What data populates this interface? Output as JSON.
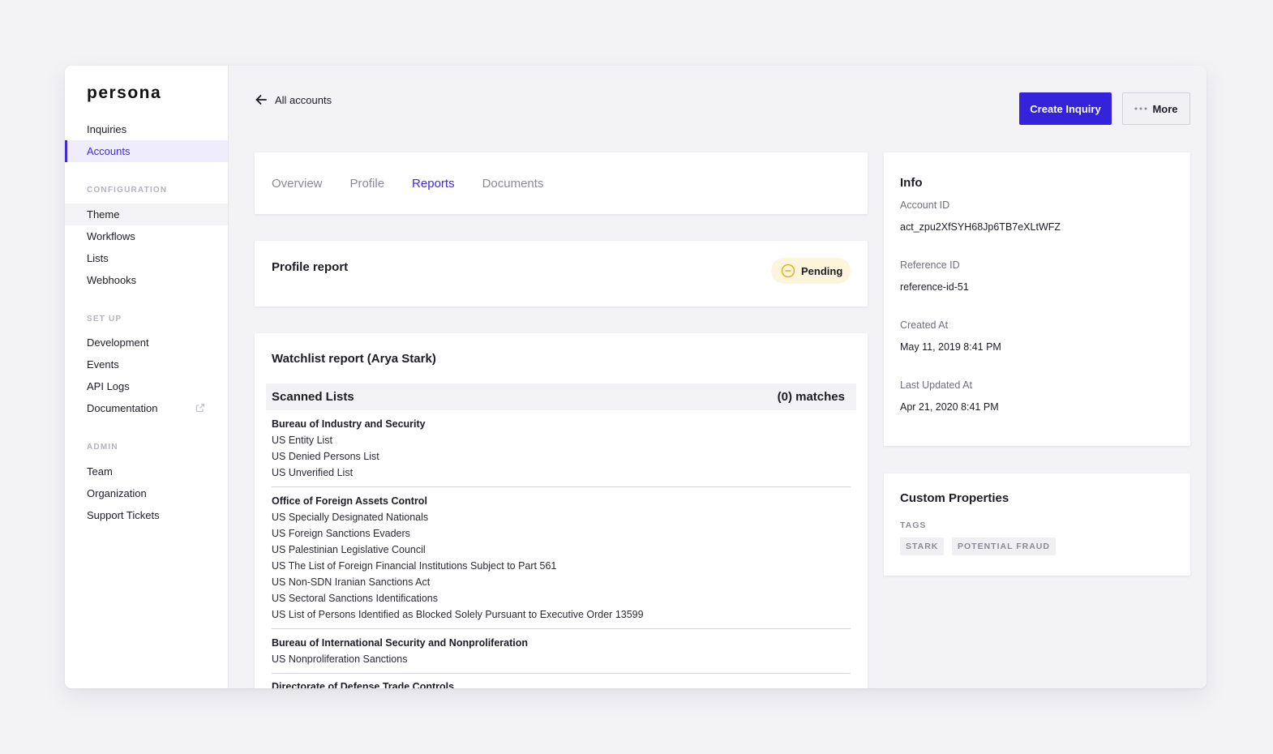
{
  "app": {
    "logo": "persona"
  },
  "sidebar": {
    "items_top": [
      {
        "label": "Inquiries"
      },
      {
        "label": "Accounts"
      }
    ],
    "configuration": {
      "heading": "CONFIGURATION",
      "items": [
        {
          "label": "Theme"
        },
        {
          "label": "Workflows"
        },
        {
          "label": "Lists"
        },
        {
          "label": "Webhooks"
        }
      ]
    },
    "setup": {
      "heading": "SET UP",
      "items": [
        {
          "label": "Development"
        },
        {
          "label": "Events"
        },
        {
          "label": "API Logs"
        },
        {
          "label": "Documentation"
        }
      ]
    },
    "admin": {
      "heading": "ADMIN",
      "items": [
        {
          "label": "Team"
        },
        {
          "label": "Organization"
        },
        {
          "label": "Support Tickets"
        }
      ]
    }
  },
  "header": {
    "back_label": "All accounts",
    "create_label": "Create Inquiry",
    "more_label": "More"
  },
  "tabs": [
    {
      "label": "Overview"
    },
    {
      "label": "Profile"
    },
    {
      "label": "Reports"
    },
    {
      "label": "Documents"
    }
  ],
  "profile_report": {
    "title": "Profile report",
    "status": "Pending"
  },
  "watchlist": {
    "title": "Watchlist report (Arya Stark)",
    "scanned_label": "Scanned Lists",
    "matches": "(0) matches",
    "groups": [
      {
        "title": "Bureau of Industry and Security",
        "items": [
          "US Entity List",
          "US Denied Persons List",
          "US Unverified List"
        ]
      },
      {
        "title": "Office of Foreign Assets Control",
        "items": [
          "US Specially Designated Nationals",
          "US Foreign Sanctions Evaders",
          "US Palestinian Legislative Council",
          "US The List of Foreign Financial Institutions Subject to Part 561",
          "US Non-SDN Iranian Sanctions Act",
          "US Sectoral Sanctions Identifications",
          "US List of Persons Identified as Blocked Solely Pursuant to Executive Order 13599"
        ]
      },
      {
        "title": "Bureau of International Security and Nonproliferation",
        "items": [
          "US Nonproliferation Sanctions"
        ]
      },
      {
        "title": "Directorate of Defense Trade Controls",
        "items": []
      }
    ]
  },
  "info": {
    "title": "Info",
    "fields": [
      {
        "label": "Account ID",
        "value": "act_zpu2XfSYH68Jp6TB7eXLtWFZ"
      },
      {
        "label": "Reference ID",
        "value": "reference-id-51"
      },
      {
        "label": "Created At",
        "value": "May 11, 2019 8:41 PM"
      },
      {
        "label": "Last Updated At",
        "value": "Apr 21, 2020 8:41 PM"
      }
    ]
  },
  "custom_properties": {
    "title": "Custom Properties",
    "tags_label": "TAGS",
    "tags": [
      "STARK",
      "POTENTIAL FRAUD"
    ]
  },
  "colors": {
    "accent": "#3523dc",
    "pending_bg": "#fdf4dc",
    "pending_icon": "#e3b02a"
  }
}
